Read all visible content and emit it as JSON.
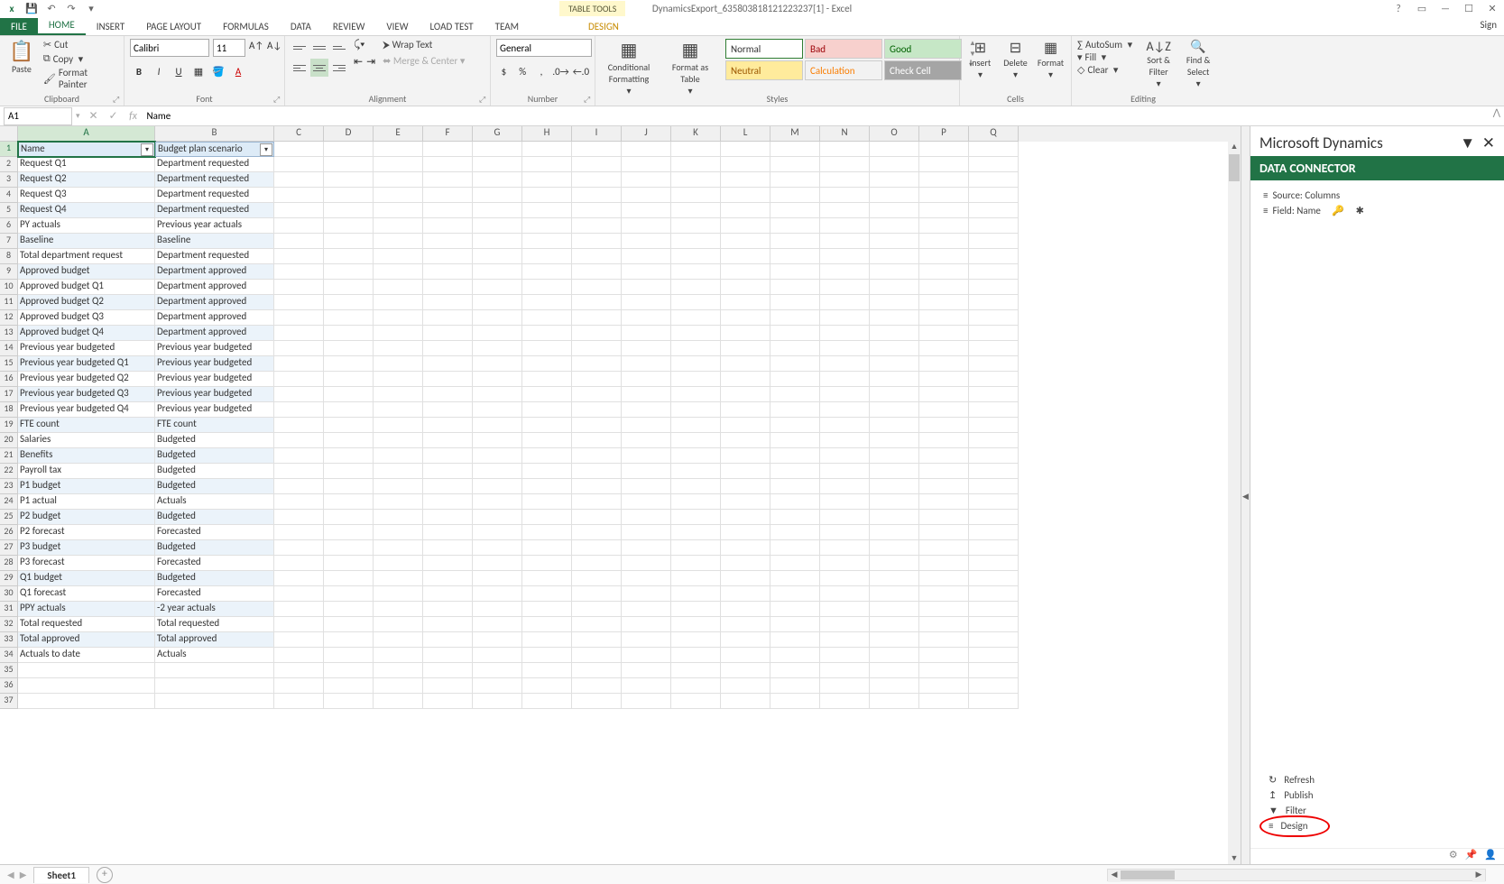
{
  "title": "DynamicsExport_635803818121223237[1] - Excel",
  "tableTools": "TABLE TOOLS",
  "signin": "Sign",
  "tabs": {
    "file": "FILE",
    "home": "HOME",
    "insert": "INSERT",
    "pageLayout": "PAGE LAYOUT",
    "formulas": "FORMULAS",
    "data": "DATA",
    "review": "REVIEW",
    "view": "VIEW",
    "loadTest": "LOAD TEST",
    "team": "TEAM",
    "design": "DESIGN"
  },
  "ribbon": {
    "clipboard": {
      "paste": "Paste",
      "cut": "Cut",
      "copy": "Copy",
      "formatPainter": "Format Painter",
      "label": "Clipboard"
    },
    "font": {
      "name": "Calibri",
      "size": "11",
      "label": "Font"
    },
    "alignment": {
      "wrap": "Wrap Text",
      "merge": "Merge & Center",
      "label": "Alignment"
    },
    "number": {
      "format": "General",
      "label": "Number"
    },
    "styles": {
      "cond": "Conditional Formatting",
      "fmtTable": "Format as Table",
      "normal": "Normal",
      "bad": "Bad",
      "good": "Good",
      "neutral": "Neutral",
      "calc": "Calculation",
      "check": "Check Cell",
      "label": "Styles"
    },
    "cells": {
      "insert": "Insert",
      "delete": "Delete",
      "format": "Format",
      "label": "Cells"
    },
    "editing": {
      "autosum": "AutoSum",
      "fill": "Fill",
      "clear": "Clear",
      "sort": "Sort & Filter",
      "find": "Find & Select",
      "label": "Editing"
    }
  },
  "nameBox": "A1",
  "formulaBar": "Name",
  "cols": [
    "A",
    "B",
    "C",
    "D",
    "E",
    "F",
    "G",
    "H",
    "I",
    "J",
    "K",
    "L",
    "M",
    "N",
    "O",
    "P",
    "Q"
  ],
  "headers": {
    "A": "Name",
    "B": "Budget plan scenario"
  },
  "rows": [
    {
      "n": 2,
      "a": "Request Q1",
      "b": "Department requested"
    },
    {
      "n": 3,
      "a": "Request Q2",
      "b": "Department requested"
    },
    {
      "n": 4,
      "a": "Request Q3",
      "b": "Department requested"
    },
    {
      "n": 5,
      "a": "Request Q4",
      "b": "Department requested"
    },
    {
      "n": 6,
      "a": "PY actuals",
      "b": "Previous year actuals"
    },
    {
      "n": 7,
      "a": "Baseline",
      "b": "Baseline"
    },
    {
      "n": 8,
      "a": "Total department request",
      "b": "Department requested"
    },
    {
      "n": 9,
      "a": "Approved budget",
      "b": "Department approved"
    },
    {
      "n": 10,
      "a": "Approved budget Q1",
      "b": "Department approved"
    },
    {
      "n": 11,
      "a": "Approved budget Q2",
      "b": "Department approved"
    },
    {
      "n": 12,
      "a": "Approved budget Q3",
      "b": "Department approved"
    },
    {
      "n": 13,
      "a": "Approved budget Q4",
      "b": "Department approved"
    },
    {
      "n": 14,
      "a": "Previous year budgeted",
      "b": "Previous year budgeted"
    },
    {
      "n": 15,
      "a": "Previous year budgeted Q1",
      "b": "Previous year budgeted"
    },
    {
      "n": 16,
      "a": "Previous year budgeted Q2",
      "b": "Previous year budgeted"
    },
    {
      "n": 17,
      "a": "Previous year budgeted Q3",
      "b": "Previous year budgeted"
    },
    {
      "n": 18,
      "a": "Previous year budgeted Q4",
      "b": "Previous year budgeted"
    },
    {
      "n": 19,
      "a": "FTE count",
      "b": "FTE count"
    },
    {
      "n": 20,
      "a": "Salaries",
      "b": "Budgeted"
    },
    {
      "n": 21,
      "a": "Benefits",
      "b": "Budgeted"
    },
    {
      "n": 22,
      "a": "Payroll tax",
      "b": "Budgeted"
    },
    {
      "n": 23,
      "a": "P1 budget",
      "b": "Budgeted"
    },
    {
      "n": 24,
      "a": "P1 actual",
      "b": "Actuals"
    },
    {
      "n": 25,
      "a": "P2 budget",
      "b": "Budgeted"
    },
    {
      "n": 26,
      "a": "P2 forecast",
      "b": "Forecasted"
    },
    {
      "n": 27,
      "a": "P3 budget",
      "b": "Budgeted"
    },
    {
      "n": 28,
      "a": "P3 forecast",
      "b": "Forecasted"
    },
    {
      "n": 29,
      "a": "Q1 budget",
      "b": "Budgeted"
    },
    {
      "n": 30,
      "a": "Q1 forecast",
      "b": "Forecasted"
    },
    {
      "n": 31,
      "a": "PPY actuals",
      "b": "-2 year actuals"
    },
    {
      "n": 32,
      "a": "Total requested",
      "b": "Total requested"
    },
    {
      "n": 33,
      "a": "Total approved",
      "b": "Total approved"
    },
    {
      "n": 34,
      "a": "Actuals to date",
      "b": "Actuals"
    }
  ],
  "emptyRows": [
    35,
    36,
    37
  ],
  "sheetTab": "Sheet1",
  "dynamics": {
    "title": "Microsoft Dynamics",
    "header": "DATA CONNECTOR",
    "source": "Source: Columns",
    "field": "Field: Name",
    "refresh": "Refresh",
    "publish": "Publish",
    "filter": "Filter",
    "design": "Design"
  }
}
